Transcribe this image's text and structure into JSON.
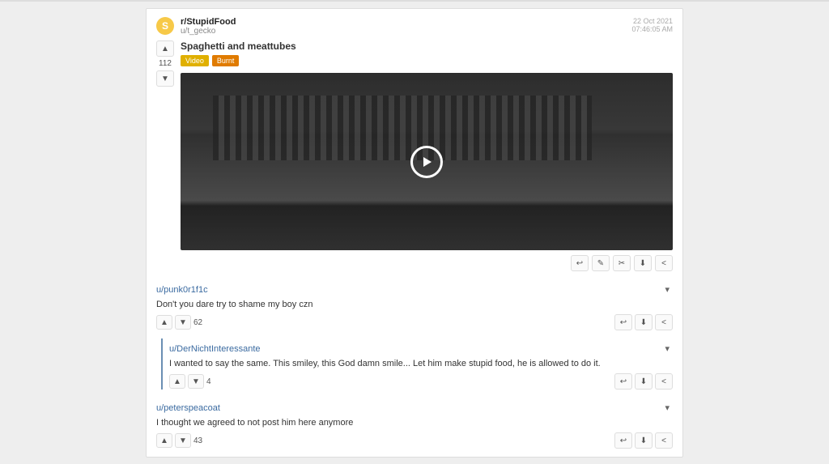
{
  "post": {
    "subreddit": "r/StupidFood",
    "subreddit_initial": "S",
    "author": "u/t_gecko",
    "date": "22 Oct 2021",
    "time": "07:46:05 AM",
    "title": "Spaghetti and meattubes",
    "score": "112",
    "tags": {
      "video": "Video",
      "burnt": "Burnt"
    }
  },
  "icons": {
    "up": "▲",
    "down": "▼",
    "collapse": "▾",
    "reply": "↩",
    "edit": "✎",
    "link": "✂",
    "download": "⬇",
    "share": "<"
  },
  "comments": [
    {
      "user": "u/punk0r1f1c",
      "text": "Don't you dare try to shame my boy czn",
      "score": "62",
      "nested": false
    },
    {
      "user": "u/DerNichtInteressante",
      "text": "I wanted to say the same. This smiley, this God damn smile... Let him make stupid food, he is allowed to do it.",
      "score": "4",
      "nested": true
    },
    {
      "user": "u/peterspeacoat",
      "text": "I thought we agreed to not post him here anymore",
      "score": "43",
      "nested": false
    }
  ]
}
